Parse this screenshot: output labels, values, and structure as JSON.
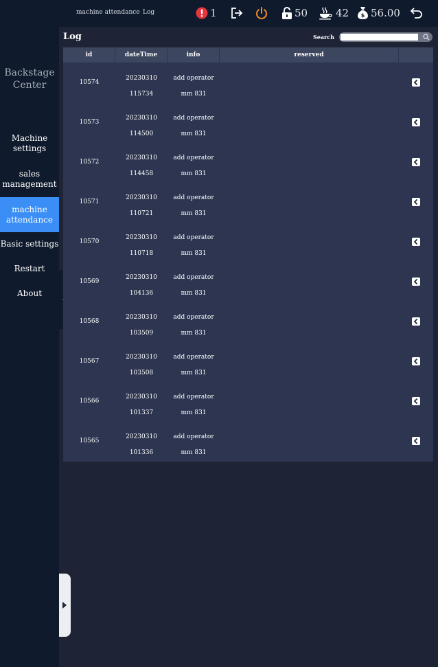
{
  "header": {
    "breadcrumbs": [
      "machine attendance",
      "Log"
    ],
    "stats": [
      {
        "icon": "alert-icon",
        "value": "1"
      },
      {
        "icon": "logout-icon",
        "value": ""
      },
      {
        "icon": "power-icon",
        "value": ""
      },
      {
        "icon": "lock-icon",
        "value": "50"
      },
      {
        "icon": "coffee-cup-icon",
        "value": "42"
      },
      {
        "icon": "money-bag-icon",
        "value": "56.00"
      },
      {
        "icon": "back-arrow-icon",
        "value": ""
      }
    ],
    "colors": {
      "alert": "#e5353d",
      "power": "#f08a28"
    }
  },
  "sidebar": {
    "brand_line1": "Backstage",
    "brand_line2": "Center",
    "items": [
      {
        "line1": "Machine",
        "line2": "settings"
      },
      {
        "line1": "sales",
        "line2": "management"
      },
      {
        "line1": "machine",
        "line2": "attendance",
        "active": true
      },
      {
        "line1": "Basic settings",
        "line2": ""
      },
      {
        "line1": "Restart",
        "line2": ""
      },
      {
        "line1": "About",
        "line2": ""
      }
    ],
    "accent": "#3a8ef5"
  },
  "main": {
    "title": "Log",
    "search_label": "Search",
    "search_value": "",
    "columns": [
      "id",
      "dateTime",
      "info",
      "reserved"
    ],
    "rows": [
      {
        "id": "10574",
        "date": "20230310",
        "time": "115734",
        "info1": "add operator",
        "info2": "mm 831"
      },
      {
        "id": "10573",
        "date": "20230310",
        "time": "114500",
        "info1": "add operator",
        "info2": "mm 831"
      },
      {
        "id": "10572",
        "date": "20230310",
        "time": "114458",
        "info1": "add operator",
        "info2": "mm 831"
      },
      {
        "id": "10571",
        "date": "20230310",
        "time": "110721",
        "info1": "add operator",
        "info2": "mm 831"
      },
      {
        "id": "10570",
        "date": "20230310",
        "time": "110718",
        "info1": "add operator",
        "info2": "mm 831"
      },
      {
        "id": "10569",
        "date": "20230310",
        "time": "104136",
        "info1": "add operator",
        "info2": "mm 831"
      },
      {
        "id": "10568",
        "date": "20230310",
        "time": "103509",
        "info1": "add operator",
        "info2": "mm 831"
      },
      {
        "id": "10567",
        "date": "20230310",
        "time": "103508",
        "info1": "add operator",
        "info2": "mm 831"
      },
      {
        "id": "10566",
        "date": "20230310",
        "time": "101337",
        "info1": "add operator",
        "info2": "mm 831"
      },
      {
        "id": "10565",
        "date": "20230310",
        "time": "101336",
        "info1": "add operator",
        "info2": "mm 831"
      }
    ]
  }
}
